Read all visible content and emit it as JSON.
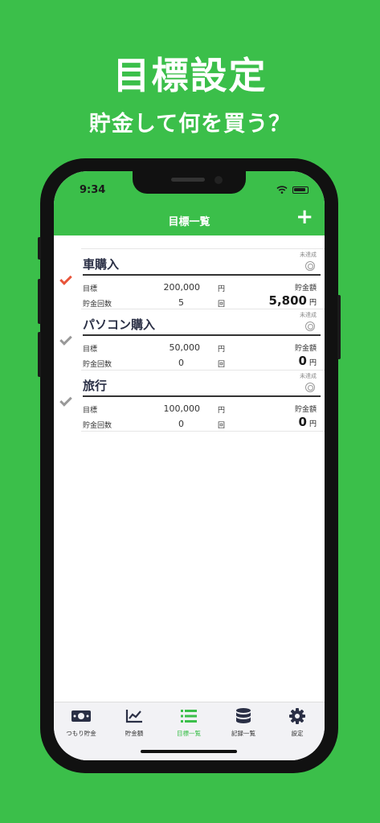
{
  "headline": "目標設定",
  "subline": "貯金して何を買う？",
  "status": {
    "time": "9:34"
  },
  "nav": {
    "title": "目標一覧",
    "add_label": "+"
  },
  "goals": [
    {
      "name": "車購入",
      "status": "未達成",
      "target_label": "目標",
      "target_value": "200,000",
      "target_unit": "円",
      "count_label": "貯金回数",
      "count_value": "5",
      "count_unit": "回",
      "saved_label": "貯金額",
      "saved_value": "5,800",
      "saved_unit": "円",
      "checked": true
    },
    {
      "name": "パソコン購入",
      "status": "未達成",
      "target_label": "目標",
      "target_value": "50,000",
      "target_unit": "円",
      "count_label": "貯金回数",
      "count_value": "0",
      "count_unit": "回",
      "saved_label": "貯金額",
      "saved_value": "0",
      "saved_unit": "円",
      "checked": false
    },
    {
      "name": "旅行",
      "status": "未達成",
      "target_label": "目標",
      "target_value": "100,000",
      "target_unit": "円",
      "count_label": "貯金回数",
      "count_value": "0",
      "count_unit": "回",
      "saved_label": "貯金額",
      "saved_value": "0",
      "saved_unit": "円",
      "checked": false
    }
  ],
  "tabs": [
    {
      "label": "つもり貯金",
      "icon": "money-icon"
    },
    {
      "label": "貯金額",
      "icon": "chart-icon"
    },
    {
      "label": "目標一覧",
      "icon": "list-icon",
      "active": true
    },
    {
      "label": "記録一覧",
      "icon": "database-icon"
    },
    {
      "label": "設定",
      "icon": "gear-icon"
    }
  ],
  "colors": {
    "brand": "#3bbf4a",
    "check_active": "#e8553b",
    "check_inactive": "#999999"
  }
}
